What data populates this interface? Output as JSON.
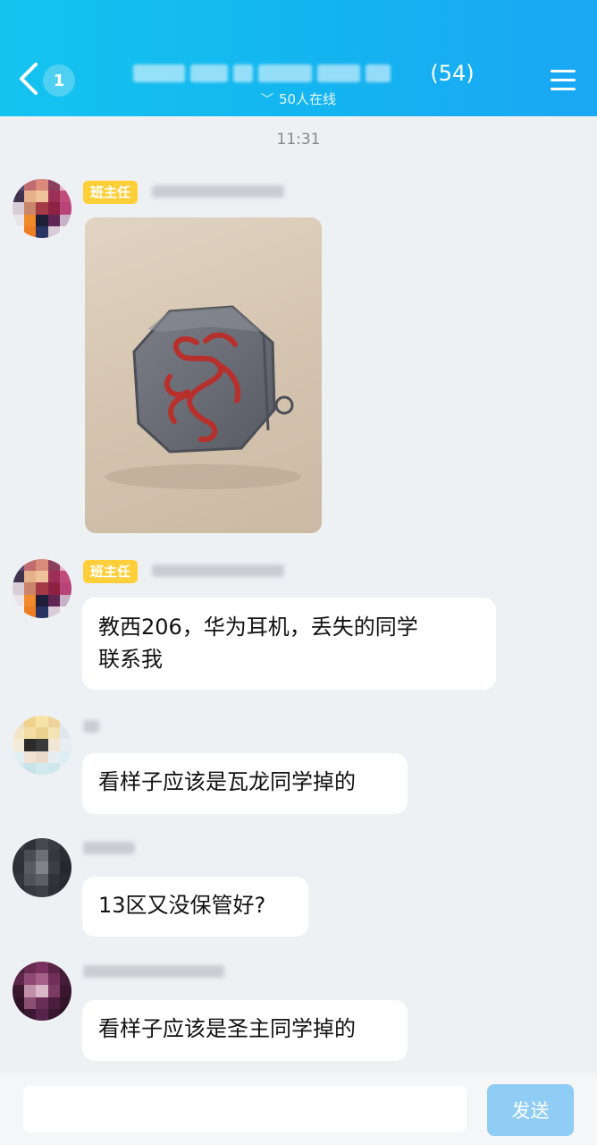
{
  "header": {
    "unread_count": "1",
    "title_suffix": "(54)",
    "online_text": "50人在线"
  },
  "chat": {
    "timestamp": "11:31",
    "messages": [
      {
        "role": "班主任",
        "type": "image"
      },
      {
        "role": "班主任",
        "text_line1": "教西206，华为耳机，丢失的同学",
        "text_line2": "联系我"
      },
      {
        "text": "看样子应该是瓦龙同学掉的"
      },
      {
        "text": "13区又没保管好?"
      },
      {
        "text": "看样子应该是圣主同学掉的"
      }
    ]
  },
  "composer": {
    "send_label": "发送"
  },
  "colors": {
    "header_start": "#14c4ef",
    "header_end": "#1aa7f4",
    "role_badge": "#ffcf3a",
    "send_button": "#90cdf5"
  }
}
